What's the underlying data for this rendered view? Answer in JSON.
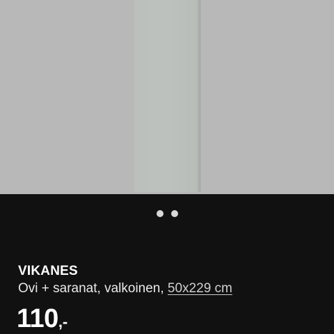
{
  "product": {
    "name": "VIKANES",
    "description_prefix": "Ovi + saranat, valkoinen, ",
    "size_link": "50x229 cm",
    "price_main": "110",
    "price_suffix": ",-"
  },
  "carousel": {
    "total_images": 2,
    "active_index": 1
  },
  "colors": {
    "image_background": "#b8b8b8",
    "door_color": "#bdc1be",
    "panel_background": "#111111"
  }
}
